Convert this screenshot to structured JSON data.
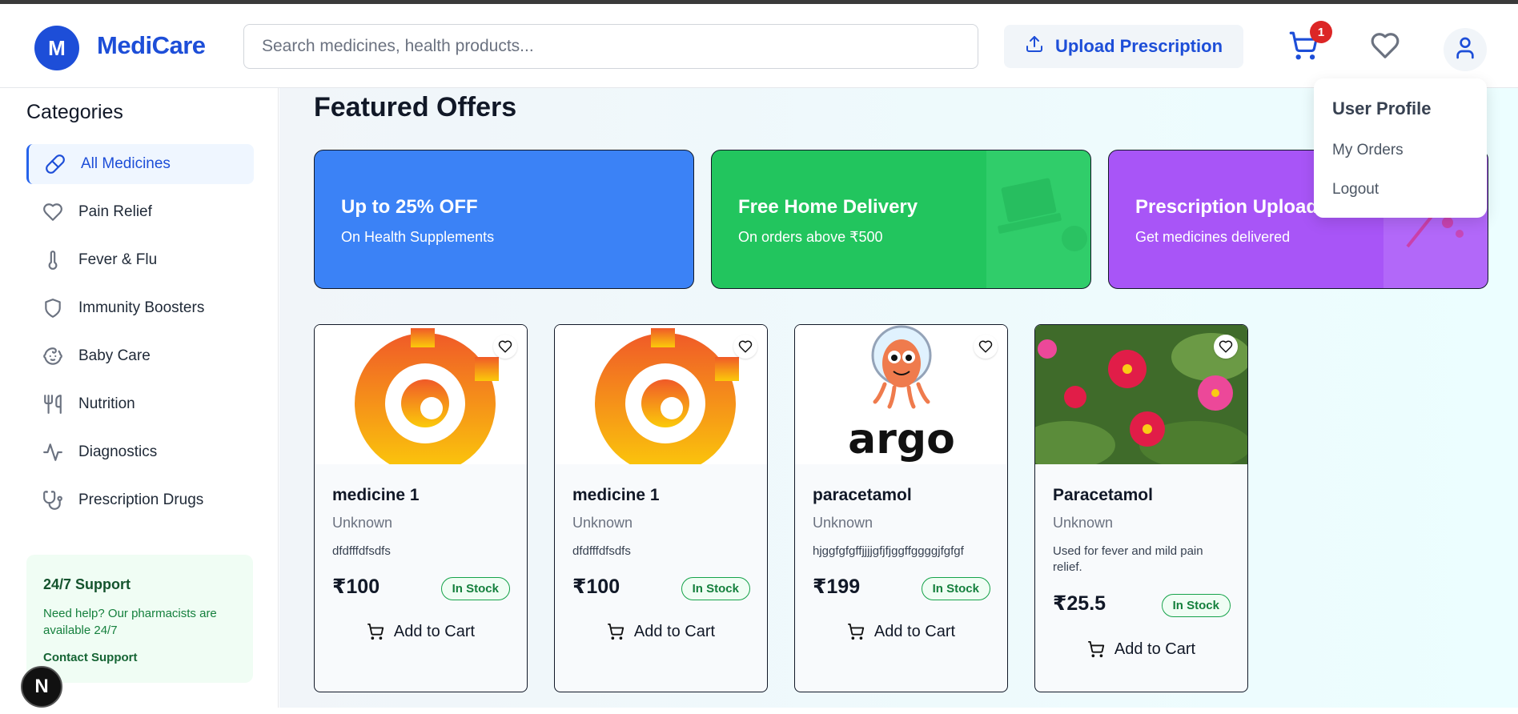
{
  "header": {
    "logo_letter": "M",
    "app_name": "MediCare",
    "search_placeholder": "Search medicines, health products...",
    "upload_label": "Upload Prescription",
    "cart_count": "1"
  },
  "sidebar": {
    "title": "Categories",
    "items": [
      {
        "label": "All Medicines",
        "icon": "pill-icon",
        "active": true
      },
      {
        "label": "Pain Relief",
        "icon": "heart-icon"
      },
      {
        "label": "Fever & Flu",
        "icon": "thermometer-icon"
      },
      {
        "label": "Immunity Boosters",
        "icon": "shield-icon"
      },
      {
        "label": "Baby Care",
        "icon": "baby-icon"
      },
      {
        "label": "Nutrition",
        "icon": "utensils-icon"
      },
      {
        "label": "Diagnostics",
        "icon": "activity-icon"
      },
      {
        "label": "Prescription Drugs",
        "icon": "stethoscope-icon"
      }
    ],
    "support": {
      "title": "24/7 Support",
      "text": "Need help? Our pharmacists are available 24/7",
      "link": "Contact Support"
    }
  },
  "main": {
    "title": "Featured Offers",
    "offers": [
      {
        "title": "Up to 25% OFF",
        "subtitle": "On Health Supplements",
        "color": "#3b82f6"
      },
      {
        "title": "Free Home Delivery",
        "subtitle": "On orders above ₹500",
        "color": "#22c55e"
      },
      {
        "title": "Prescription Upload",
        "subtitle": "Get medicines delivered",
        "color": "#a855f7"
      }
    ],
    "products": [
      {
        "name": "medicine 1",
        "brand": "Unknown",
        "description": "dfdfffdfsdfs",
        "price": "₹100",
        "stock": "In Stock",
        "add_label": "Add to Cart",
        "image": "grafana-logo"
      },
      {
        "name": "medicine 1",
        "brand": "Unknown",
        "description": "dfdfffdfsdfs",
        "price": "₹100",
        "stock": "In Stock",
        "add_label": "Add to Cart",
        "image": "grafana-logo"
      },
      {
        "name": "paracetamol",
        "brand": "Unknown",
        "description": "hjggfgfgffjjjjgfjfjggffggggjfgfgf",
        "price": "₹199",
        "stock": "In Stock",
        "add_label": "Add to Cart",
        "image": "argo-logo"
      },
      {
        "name": "Paracetamol",
        "brand": "Unknown",
        "description": "Used for fever and mild pain relief.",
        "price": "₹25.5",
        "stock": "In Stock",
        "add_label": "Add to Cart",
        "image": "flowers-photo"
      }
    ]
  },
  "user_menu": {
    "header": "User Profile",
    "items": [
      "My Orders",
      "Logout"
    ]
  },
  "dev_badge": "N",
  "colors": {
    "brand": "#1d4ed8",
    "stock_green": "#16a34a",
    "badge_red": "#dc2626"
  }
}
